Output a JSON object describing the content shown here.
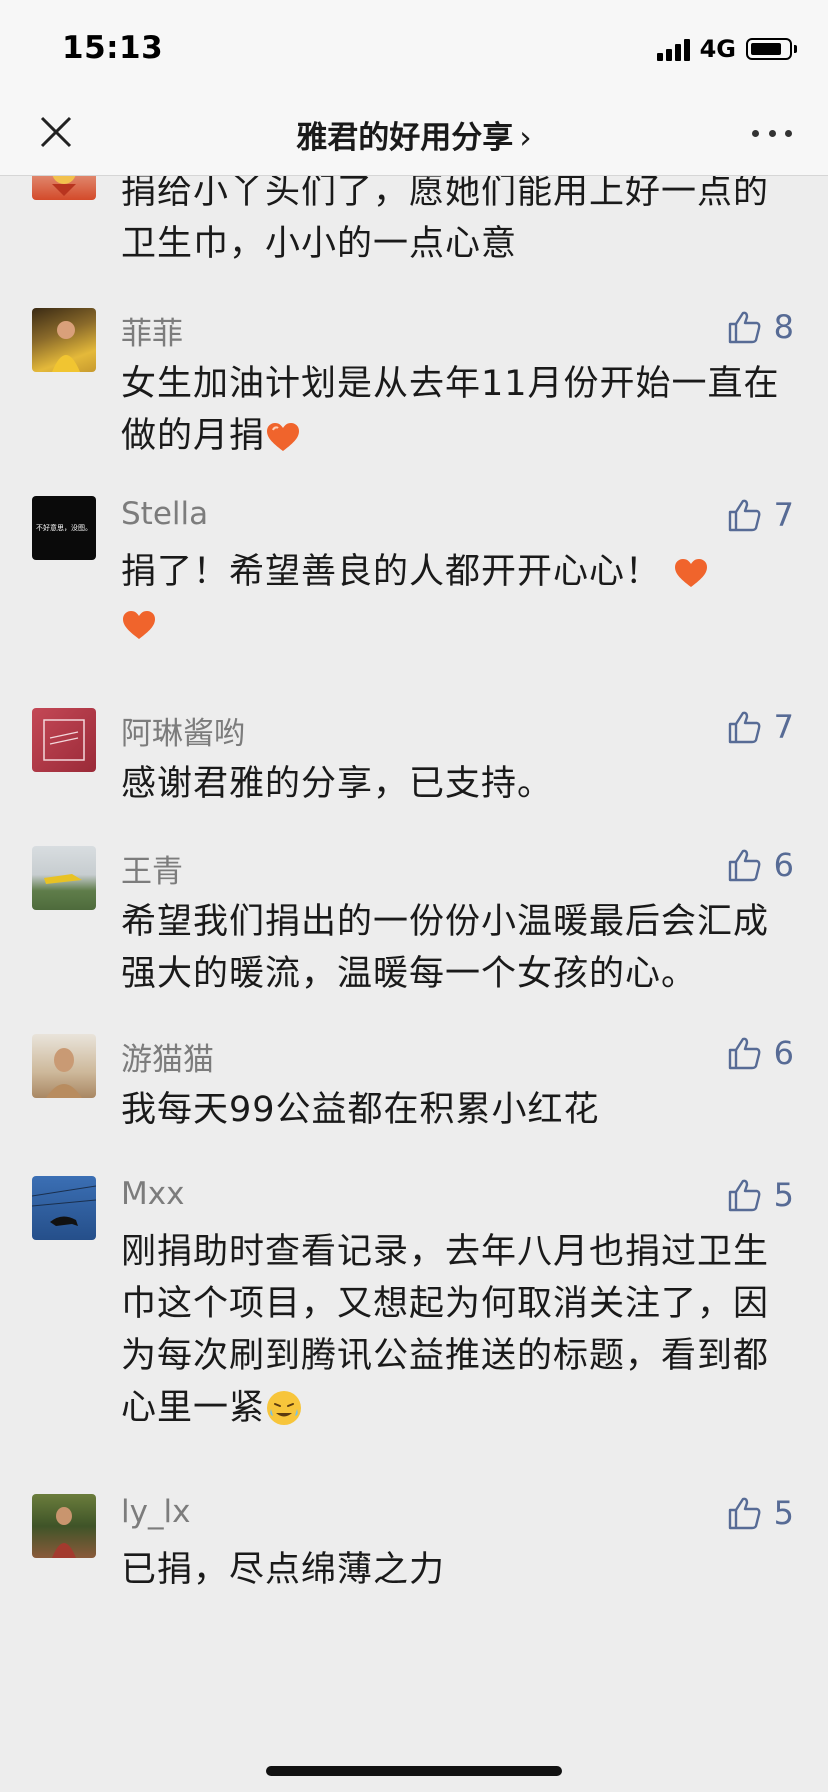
{
  "status": {
    "time": "15:13",
    "network": "4G"
  },
  "nav": {
    "title": "雅君的好用分享",
    "chevron": "›"
  },
  "icons": {
    "close": "close-icon",
    "more": "more-icon",
    "like": "thumbs-up-icon",
    "heart": "heart-icon"
  },
  "colors": {
    "like": "#576b95",
    "name": "#7c7c7c",
    "text": "#1a1a1a",
    "background": "#ededed"
  },
  "partial_comment": {
    "text": "捐给小丫头们了，愿她们能用上好一点的卫生巾，小小的一点心意"
  },
  "comments": [
    {
      "name": "菲菲",
      "likes": "8",
      "text": "女生加油计划是从去年11月份开始一直在做的月捐"
    },
    {
      "name": "Stella",
      "likes": "7",
      "avatar_text": "不好意思，没图。",
      "text": "捐了！希望善良的人都开开心心！"
    },
    {
      "name": "阿琳酱哟",
      "likes": "7",
      "text": "感谢君雅的分享，已支持。"
    },
    {
      "name": "王青",
      "likes": "6",
      "text": "希望我们捐出的一份份小温暖最后会汇成强大的暖流，温暖每一个女孩的心。"
    },
    {
      "name": "游猫猫",
      "likes": "6",
      "text": "我每天99公益都在积累小红花"
    },
    {
      "name": "Mxx",
      "likes": "5",
      "text": "刚捐助时查看记录，去年八月也捐过卫生巾这个项目，又想起为何取消关注了，因为每次刷到腾讯公益推送的标题，看到都心里一紧"
    },
    {
      "name": "ly_lx",
      "likes": "5",
      "text": "已捐，尽点绵薄之力"
    }
  ]
}
